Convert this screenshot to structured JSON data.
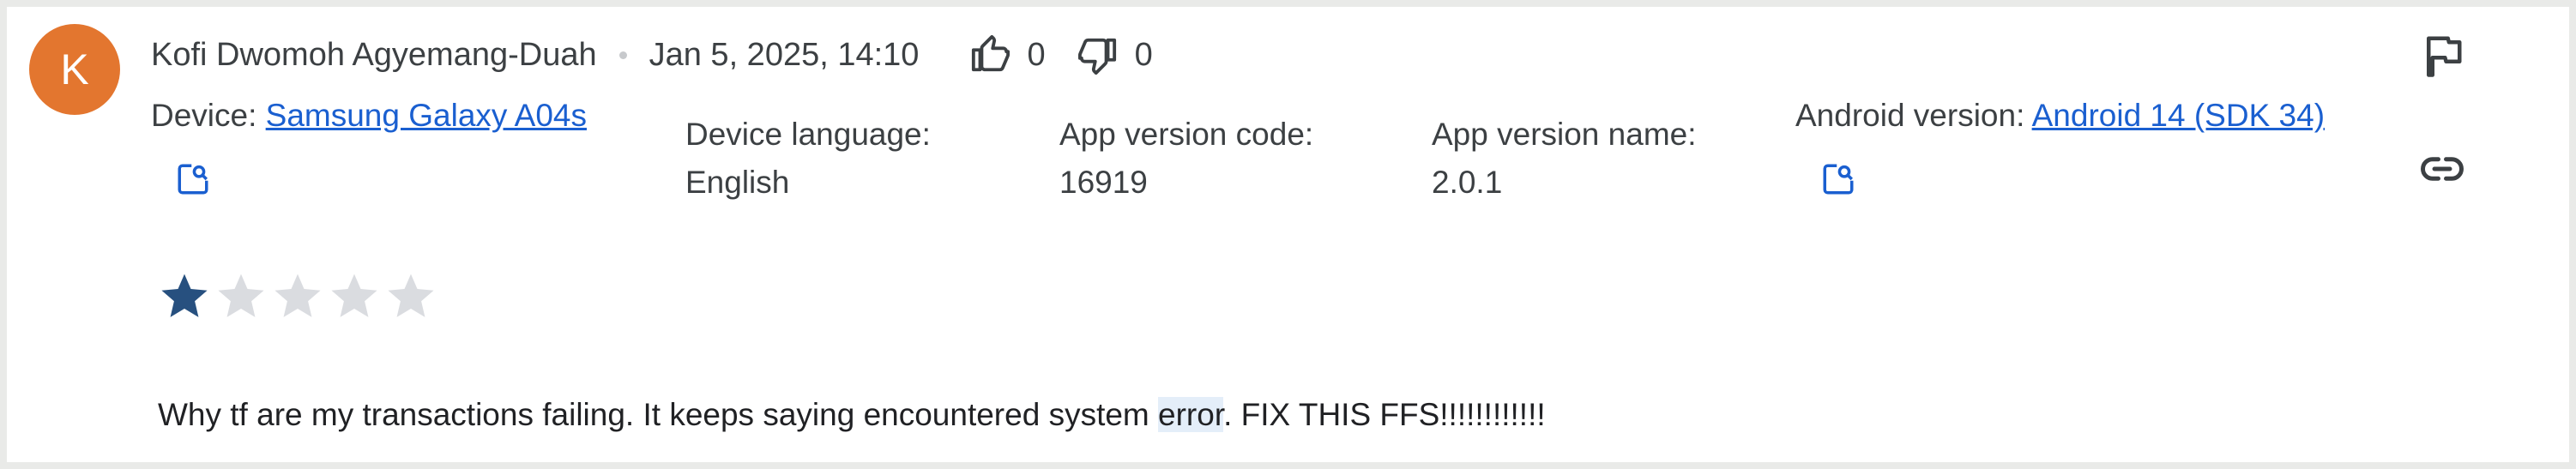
{
  "review": {
    "author": {
      "initial": "K",
      "name": "Kofi Dwomoh Agyemang-Duah",
      "avatar_color": "#e3762f"
    },
    "date": "Jan 5, 2025, 14:10",
    "thumbs_up_count": "0",
    "thumbs_down_count": "0",
    "device": {
      "label": "Device: ",
      "value": "Samsung Galaxy A04s"
    },
    "device_language": {
      "label": "Device language:",
      "value": "English"
    },
    "app_version_code": {
      "label": "App version code:",
      "value": "16919"
    },
    "app_version_name": {
      "label": "App version name:",
      "value": "2.0.1"
    },
    "android_version": {
      "label": "Android version: ",
      "value": "Android 14 (SDK 34)"
    },
    "rating": 1,
    "max_rating": 5,
    "text_before": "Why tf are my transactions failing. It keeps saying encountered system ",
    "text_highlight": "error",
    "text_after": ". FIX THIS FFS!!!!!!!!!!!!"
  },
  "icons": {
    "thumbs_up": "thumbs-up-icon",
    "thumbs_down": "thumbs-down-icon",
    "flag": "flag-icon",
    "link": "link-icon",
    "search": "search-device-icon",
    "star": "star-icon"
  },
  "colors": {
    "link": "#1a5fd0",
    "star_filled": "#27507f",
    "star_empty": "#dadce0",
    "highlight": "#e4eef9",
    "background": "#e9eae8"
  }
}
